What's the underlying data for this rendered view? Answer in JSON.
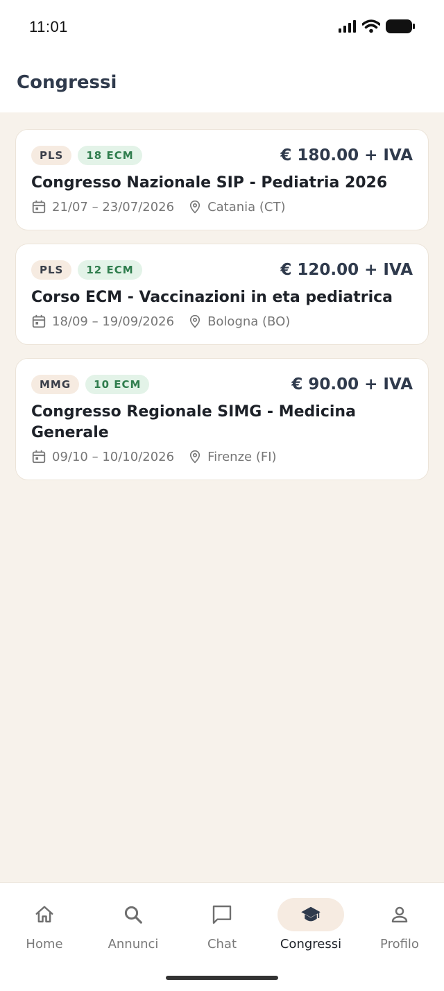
{
  "status_bar": {
    "time": "11:01"
  },
  "header": {
    "title": "Congressi"
  },
  "congresses": [
    {
      "category": "PLS",
      "ecm": "18 ECM",
      "price": "€ 180.00 + IVA",
      "title": "Congresso Nazionale SIP - Pediatria 2026",
      "dates": "21/07 – 23/07/2026",
      "location": "Catania (CT)"
    },
    {
      "category": "PLS",
      "ecm": "12 ECM",
      "price": "€ 120.00 + IVA",
      "title": "Corso ECM - Vaccinazioni in eta pediatrica",
      "dates": "18/09 – 19/09/2026",
      "location": "Bologna (BO)"
    },
    {
      "category": "MMG",
      "ecm": "10 ECM",
      "price": "€ 90.00 + IVA",
      "title": "Congresso Regionale SIMG - Medicina Generale",
      "dates": "09/10 – 10/10/2026",
      "location": "Firenze (FI)"
    }
  ],
  "nav": {
    "items": [
      {
        "label": "Home",
        "icon": "home-icon"
      },
      {
        "label": "Annunci",
        "icon": "search-icon"
      },
      {
        "label": "Chat",
        "icon": "chat-icon"
      },
      {
        "label": "Congressi",
        "icon": "graduation-cap-icon",
        "active": true
      },
      {
        "label": "Profilo",
        "icon": "person-icon"
      }
    ]
  },
  "colors": {
    "background": "#f7f2eb",
    "title": "#2f3a4c",
    "ecm_tag_bg": "#e3f3e8",
    "ecm_tag_text": "#2f7d4d",
    "category_tag_bg": "#f6ebe1",
    "active_nav_bg": "#f6ebe1"
  }
}
